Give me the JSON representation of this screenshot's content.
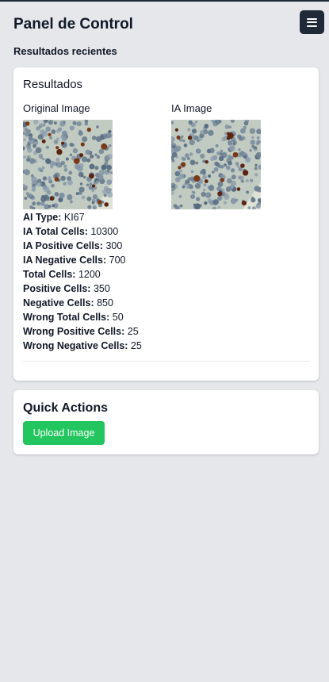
{
  "header": {
    "title": "Panel de Control",
    "menu_icon": "hamburger-menu-icon"
  },
  "subtitle": "Resultados recientes",
  "results": {
    "title": "Resultados",
    "original_label": "Original Image",
    "ia_label": "IA Image",
    "stats": [
      {
        "label": "AI Type:",
        "value": "KI67"
      },
      {
        "label": "IA Total Cells:",
        "value": "10300"
      },
      {
        "label": "IA Positive Cells:",
        "value": "300"
      },
      {
        "label": "IA Negative Cells:",
        "value": "700"
      },
      {
        "label": "Total Cells:",
        "value": "1200"
      },
      {
        "label": "Positive Cells:",
        "value": "350"
      },
      {
        "label": "Negative Cells:",
        "value": "850"
      },
      {
        "label": "Wrong Total Cells:",
        "value": "50"
      },
      {
        "label": "Wrong Positive Cells:",
        "value": "25"
      },
      {
        "label": "Wrong Negative Cells:",
        "value": "25"
      }
    ]
  },
  "quick_actions": {
    "title": "Quick Actions",
    "upload_label": "Upload Image"
  },
  "colors": {
    "background": "#e5e7eb",
    "menu_button": "#1f2937",
    "upload_button": "#22c55e"
  }
}
